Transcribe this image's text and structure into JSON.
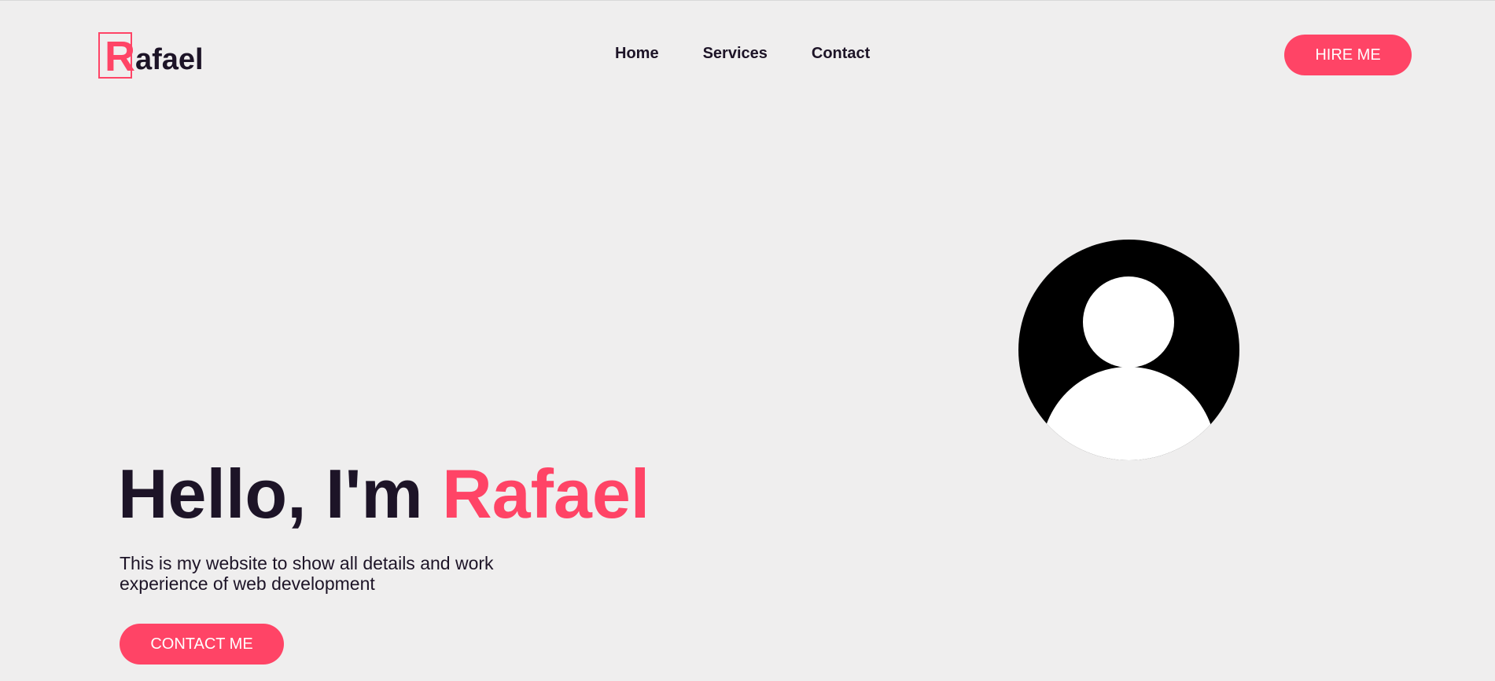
{
  "logo": {
    "initial": "R",
    "rest": "afael"
  },
  "nav": {
    "items": [
      {
        "label": "Home"
      },
      {
        "label": "Services"
      },
      {
        "label": "Contact"
      }
    ]
  },
  "header": {
    "hire_label": "HIRE ME"
  },
  "hero": {
    "title_prefix": "Hello, I'm ",
    "title_name": "Rafael",
    "description": "This is my website to show all details and work experience of web development",
    "contact_label": "CONTACT ME"
  },
  "colors": {
    "accent": "#ff4466",
    "text": "#1d1427",
    "background": "#efeeee"
  },
  "icons": {
    "avatar": "user-avatar-icon"
  }
}
